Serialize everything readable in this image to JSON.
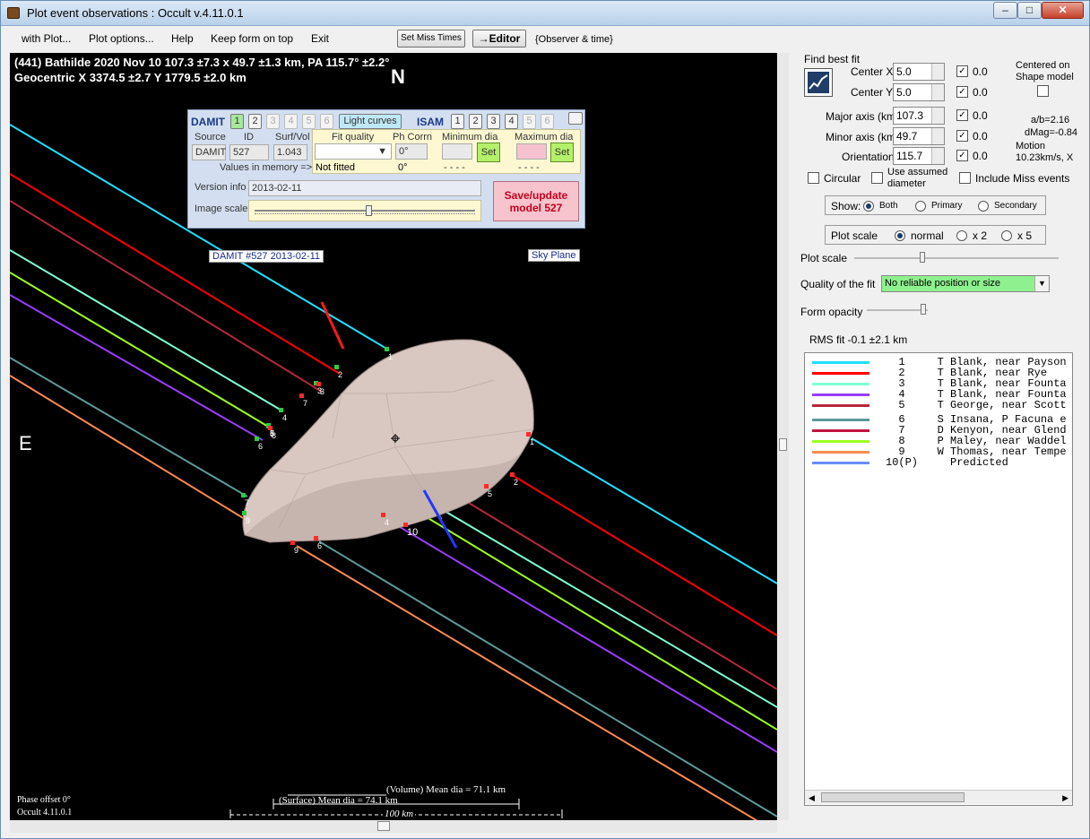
{
  "window": {
    "title": "Plot event observations : Occult v.4.11.0.1",
    "min": "–",
    "max": "□",
    "close": "✕"
  },
  "menu": {
    "items": [
      "with Plot...",
      "Plot options...",
      "Help",
      "Keep form on top",
      "Exit"
    ],
    "set_miss": "Set Miss Times",
    "editor": "→Editor",
    "observer_time": "{Observer & time}"
  },
  "plot": {
    "header1": "(441) Bathilde  2020 Nov 10   107.3 ±7.3 x 49.7 ±1.3 km, PA 115.7° ±2.2°",
    "header2": "Geocentric  X  3374.5 ±2.7  Y 1779.5 ±2.0 km",
    "north": "N",
    "east": "E",
    "damit_label": "DAMIT #527 2013-02-11",
    "sky_plane": "Sky Plane",
    "surface": "(Surface) Mean dia = 74.1 km",
    "volume": "(Volume) Mean dia = 71.1 km",
    "scale": "100 km",
    "phase": "Phase offset 0°",
    "version": "Occult 4.11.0.1",
    "chord_labels": [
      "1",
      "2",
      "3",
      "4",
      "5",
      "6",
      "7",
      "8",
      "9",
      "1",
      "2",
      "3",
      "4",
      "5",
      "6",
      "7",
      "8",
      "9",
      "10"
    ]
  },
  "damit": {
    "title": "DAMIT",
    "isam": "ISAM",
    "numbers": [
      "1",
      "2",
      "3",
      "4",
      "5",
      "6"
    ],
    "light_curves": "Light curves",
    "source": "Source",
    "id": "ID",
    "surf_vol": "Surf/Vol",
    "source_val": "DAMIT",
    "id_val": "527",
    "surf_vol_val": "1.043",
    "fit_quality": "Fit quality",
    "ph_corrn": "Ph Corrn",
    "min_dia": "Minimum dia",
    "max_dia": "Maximum dia",
    "ph_val": "0°",
    "set": "Set",
    "values_mem": "Values in memory =>",
    "not_fitted": "Not fitted",
    "ph_mem": "0°",
    "dashes": "- - - -",
    "version_info": "Version info",
    "version_val": "2013-02-11",
    "image_scale": "Image scale",
    "save1": "Save/update",
    "save2": "model 527"
  },
  "right": {
    "find_best_fit": "Find best fit",
    "center_x": "Center X",
    "center_x_val": "5.0",
    "center_y": "Center Y",
    "center_y_val": "5.0",
    "major": "Major axis (km)",
    "major_val": "107.3",
    "minor": "Minor axis (km)",
    "minor_val": "49.7",
    "orient": "Orientation",
    "orient_val": "115.7",
    "zero": "0.0",
    "centered1": "Centered on",
    "centered2": "Shape model",
    "ab": "a/b=2.16",
    "dmag": "dMag=-0.84",
    "motion1": "Motion",
    "motion2": "10.23km/s, X",
    "circular": "Circular",
    "assumed1": "Use assumed",
    "assumed2": "diameter",
    "include_miss": "Include Miss events",
    "show": "Show:",
    "both": "Both",
    "primary": "Primary",
    "secondary": "Secondary",
    "plot_scale": "Plot scale",
    "normal": "normal",
    "x2": "x 2",
    "x5": "x 5",
    "plot_scale2": "Plot scale",
    "quality": "Quality of the fit",
    "quality_val": "No reliable position or size",
    "form_opacity": "Form opacity",
    "rms": "RMS fit -0.1 ±2.1 km"
  },
  "legend": [
    {
      "n": "1",
      "name": "T Blank, near Payson",
      "color": "#22e0ff"
    },
    {
      "n": "2",
      "name": "T Blank, near Rye",
      "color": "#ff0000"
    },
    {
      "n": "3",
      "name": "T Blank, near Founta",
      "color": "#7dffd5"
    },
    {
      "n": "4",
      "name": "T Blank, near Founta",
      "color": "#9a3dff"
    },
    {
      "n": "5",
      "name": "T George, near Scott",
      "color": "#b4283a"
    },
    {
      "n": "6",
      "name": "S Insana, P Facuna e",
      "color": "#5c9a9a"
    },
    {
      "n": "7",
      "name": "D Kenyon, near Glend",
      "color": "#c01540"
    },
    {
      "n": "8",
      "name": "P Maley, near Waddel",
      "color": "#9dff20"
    },
    {
      "n": "9",
      "name": "W Thomas, near Tempe",
      "color": "#ff8a50"
    },
    {
      "n": "10(P)",
      "name": "Predicted",
      "color": "#6a8cff"
    }
  ]
}
